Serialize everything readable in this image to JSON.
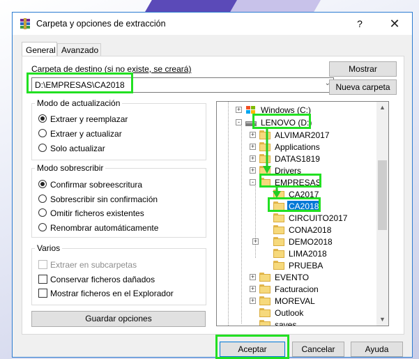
{
  "window": {
    "title": "Carpeta y opciones de extracción",
    "help_label": "?",
    "close_label": "✕"
  },
  "tabs": [
    {
      "label": "General",
      "active": true
    },
    {
      "label": "Avanzado",
      "active": false
    }
  ],
  "destination": {
    "label_prefix": "Carpeta de destino (si no existe, se creará)",
    "value": "D:\\EMPRESAS\\CA2018",
    "show_button": "Mostrar",
    "new_folder_button": "Nueva carpeta"
  },
  "update_mode": {
    "title": "Modo de actualización",
    "options": [
      "Extraer y reemplazar",
      "Extraer y actualizar",
      "Solo actualizar"
    ],
    "selected": "Extraer y reemplazar"
  },
  "overwrite_mode": {
    "title": "Modo sobrescribir",
    "options": [
      "Confirmar sobreescritura",
      "Sobrescribir sin confirmación",
      "Omitir ficheros existentes",
      "Renombrar automáticamente"
    ],
    "selected": "Confirmar sobreescritura"
  },
  "misc": {
    "title": "Varios",
    "options": [
      {
        "label": "Extraer en subcarpetas",
        "checked": false,
        "disabled": true
      },
      {
        "label": "Conservar ficheros dañados",
        "checked": false,
        "disabled": false
      },
      {
        "label": "Mostrar ficheros en el Explorador",
        "checked": false,
        "disabled": false
      }
    ],
    "save_button": "Guardar opciones"
  },
  "tree": {
    "nodes": [
      {
        "label": "Windows (C:)",
        "expander": "+",
        "icon": "drive-c-icon"
      },
      {
        "label": "LENOVO (D:)",
        "expander": "-",
        "icon": "drive-d-icon"
      },
      {
        "label": "ALVIMAR2017",
        "expander": "+"
      },
      {
        "label": "Applications",
        "expander": "+"
      },
      {
        "label": "DATAS1819",
        "expander": "+"
      },
      {
        "label": "Drivers",
        "expander": "+"
      },
      {
        "label": "EMPRESAS",
        "expander": "-"
      },
      {
        "label": "CA2017",
        "expander": ""
      },
      {
        "label": "CA2018",
        "expander": "",
        "selected": true
      },
      {
        "label": "CIRCUITO2017",
        "expander": ""
      },
      {
        "label": "CONA2018",
        "expander": ""
      },
      {
        "label": "DEMO2018",
        "expander": "+"
      },
      {
        "label": "LIMA2018",
        "expander": ""
      },
      {
        "label": "PRUEBA",
        "expander": ""
      },
      {
        "label": "EVENTO",
        "expander": "+"
      },
      {
        "label": "Facturacion",
        "expander": "+"
      },
      {
        "label": "MOREVAL",
        "expander": "+"
      },
      {
        "label": "Outlook",
        "expander": ""
      },
      {
        "label": "saves",
        "expander": ""
      }
    ]
  },
  "footer": {
    "ok": "Aceptar",
    "cancel": "Cancelar",
    "help": "Ayuda"
  },
  "colors": {
    "highlight": "#22e022",
    "selection": "#0078d7",
    "window_border": "#2b7bd1"
  }
}
